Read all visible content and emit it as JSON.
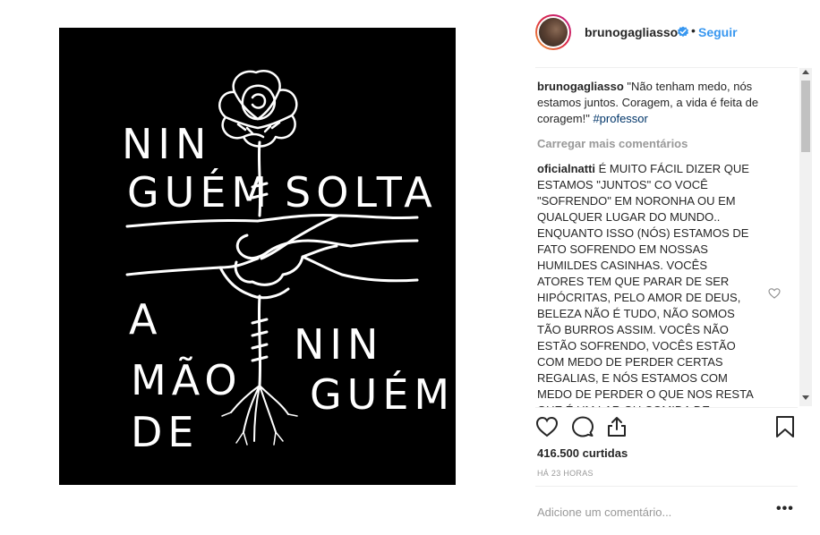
{
  "post": {
    "username": "brunogagliasso",
    "follow_label": "Seguir",
    "separator": "•"
  },
  "image_text": {
    "line1": "NIN",
    "line2a": "GUÉM",
    "line2b": "SOLTA",
    "line3a": "A",
    "line3b": "NIN",
    "line4a": "MÃO",
    "line4b": "GUÉM",
    "line5": "DE"
  },
  "caption": {
    "username": "brunogagliasso",
    "text": "\"Não tenham medo, nós estamos juntos. Coragem, a vida é feita de coragem!\"",
    "hashtag": "#professor"
  },
  "load_more_label": "Carregar mais comentários",
  "comment": {
    "username": "oficialnatti",
    "text": "É MUITO FÁCIL DIZER QUE ESTAMOS \"JUNTOS\" CO VOCÊ \"SOFRENDO\" EM NORONHA OU EM QUALQUER LUGAR DO MUNDO.. ENQUANTO ISSO (NÓS) ESTAMOS DE FATO SOFRENDO EM NOSSAS HUMILDES CASINHAS. VOCÊS ATORES TEM QUE PARAR DE SER HIPÓCRITAS, PELO AMOR DE DEUS, BELEZA NÃO É TUDO, NÃO SOMOS TÃO BURROS ASSIM. VOCÊS NÃO ESTÃO SOFRENDO, VOCÊS ESTÃO COM MEDO DE PERDER CERTAS REGALIAS, E NÓS ESTAMOS COM MEDO DE PERDER O QUE NOS RESTA QUE É UM LAR OU COMIDA DE QUALIDADE OU A"
  },
  "likes": "416.500 curtidas",
  "timestamp": "HÁ 23 HORAS",
  "comment_input": {
    "placeholder": "Adicione um comentário..."
  },
  "more_options_label": "•••",
  "icons": {
    "avatar": "profile-avatar",
    "verified": "verified-badge-icon",
    "like": "heart-icon",
    "comment": "speech-bubble-icon",
    "share": "share-icon",
    "save": "bookmark-icon",
    "comment_like": "small-heart-icon"
  },
  "colors": {
    "link_blue": "#3897f0",
    "hashtag_blue": "#003569",
    "muted_gray": "#999999",
    "text": "#262626",
    "divider": "#efefef"
  }
}
